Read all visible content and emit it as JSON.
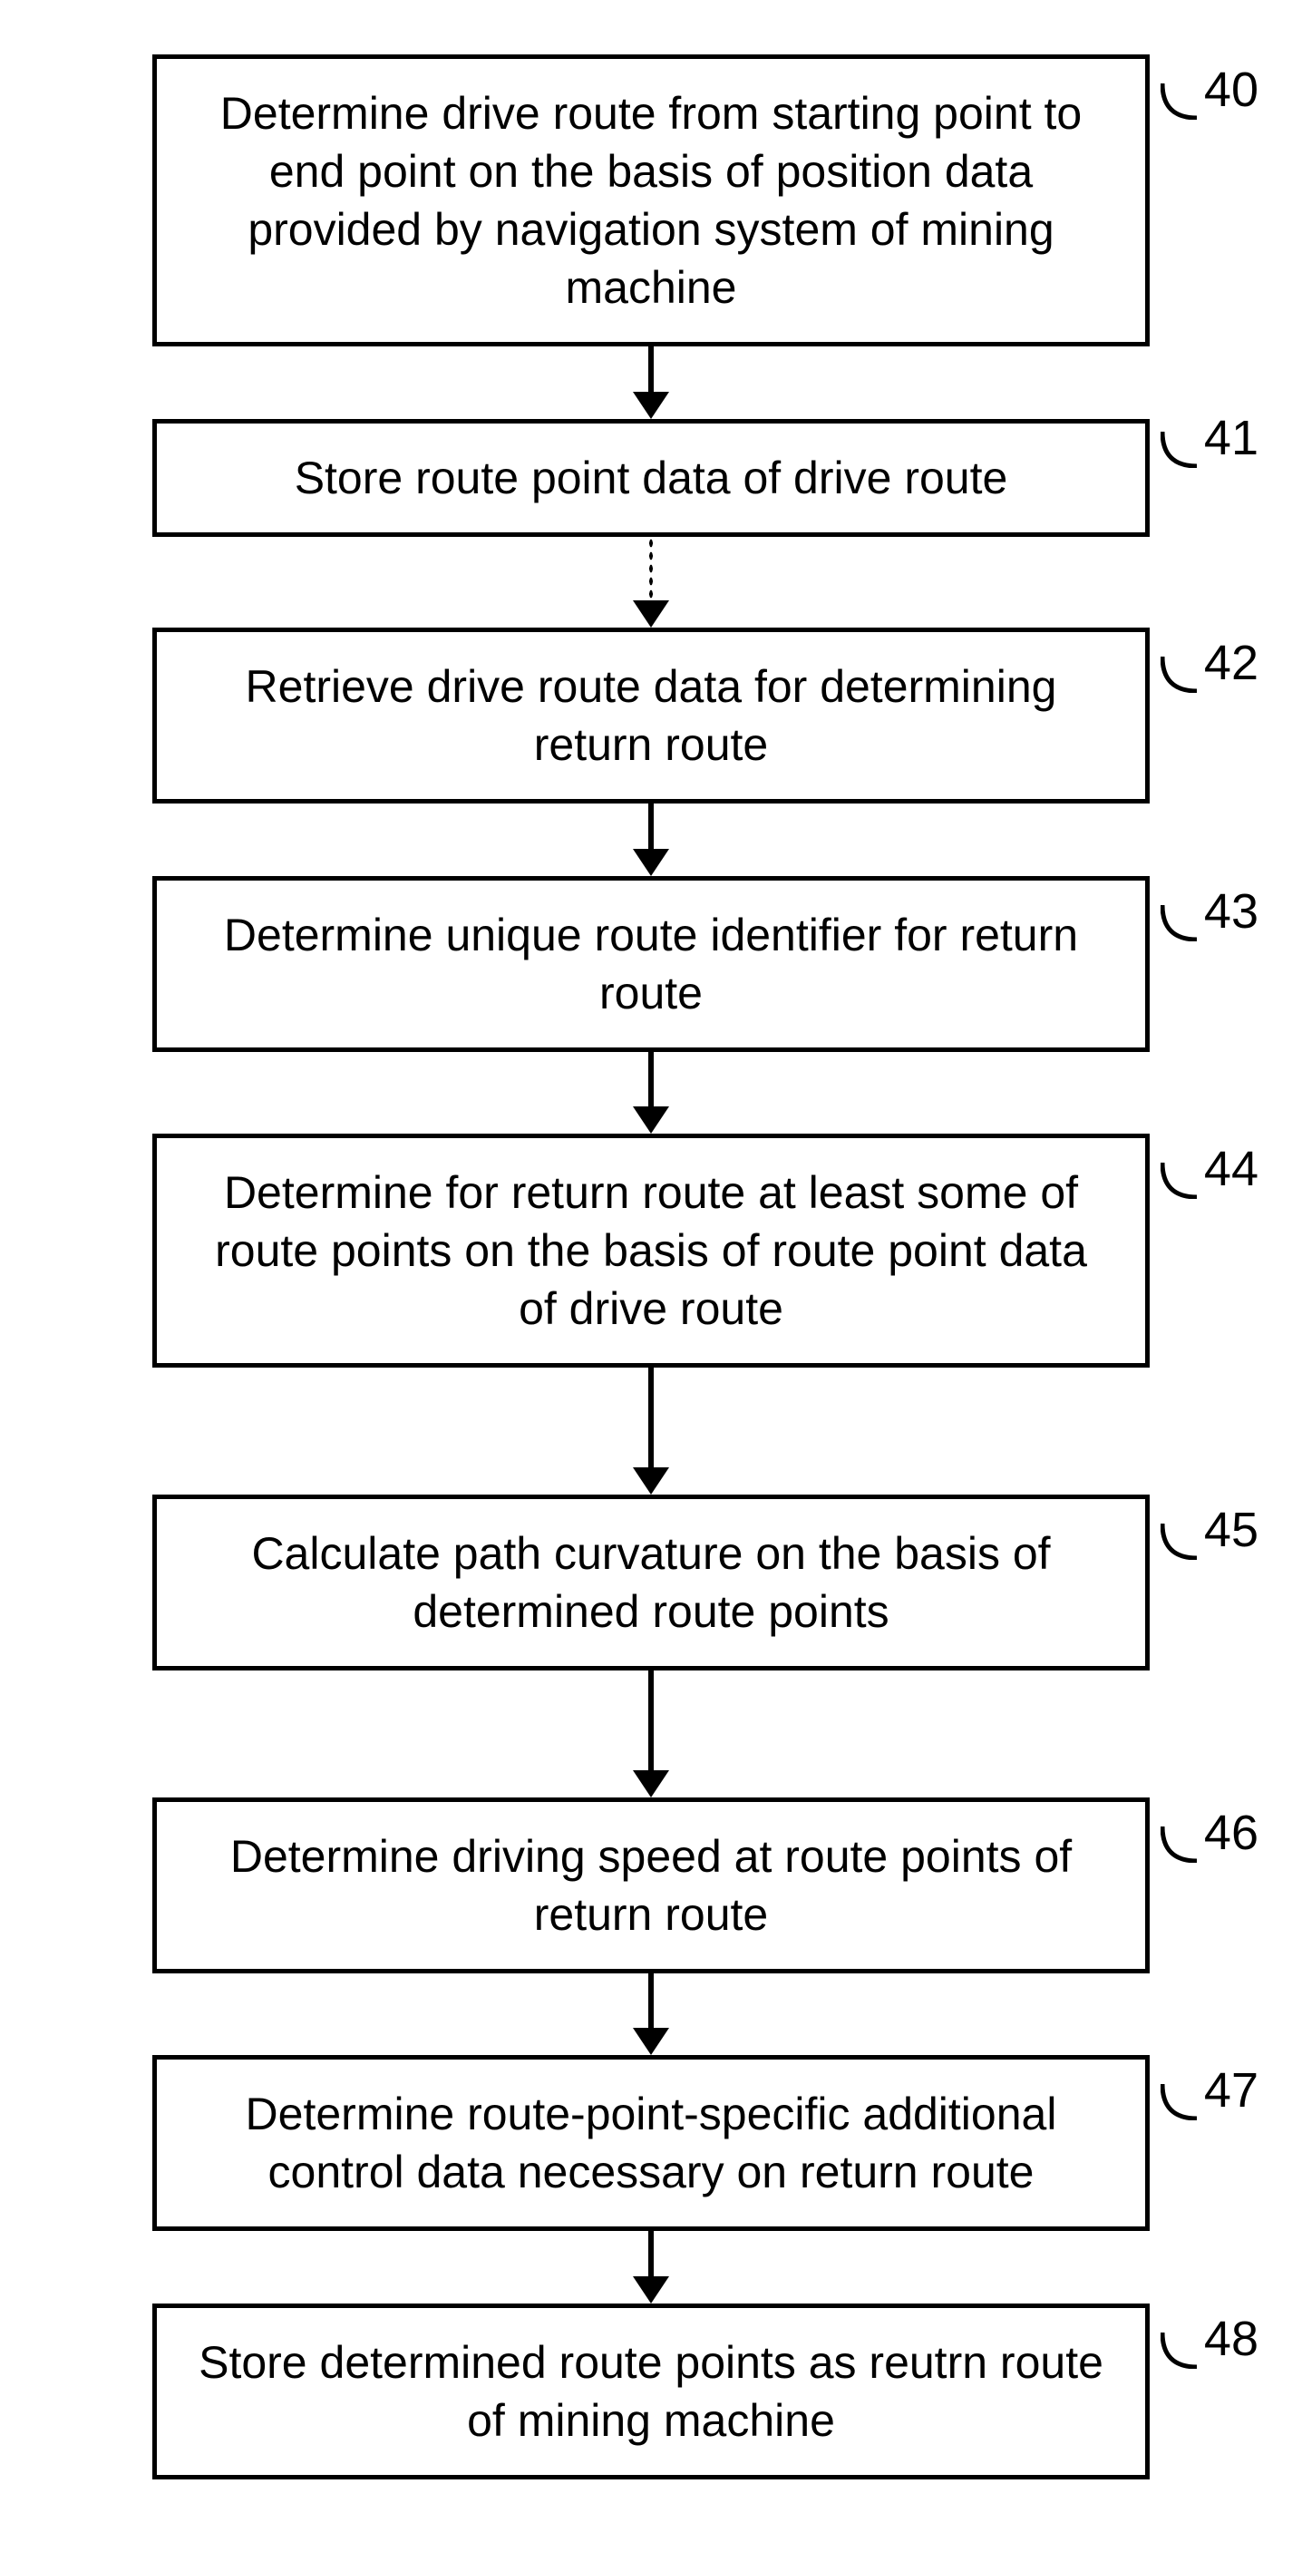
{
  "diagram": {
    "type": "flowchart",
    "steps": [
      {
        "id": "40",
        "text": "Determine drive route from starting point to end point on the basis of position data provided by navigation system of mining machine",
        "height": "h1",
        "arrow_after": "solid"
      },
      {
        "id": "41",
        "text": "Store route point data of drive route",
        "height": "h4",
        "arrow_after": "dotted"
      },
      {
        "id": "42",
        "text": "Retrieve drive route data for determining return route",
        "height": "h2",
        "arrow_after": "solid"
      },
      {
        "id": "43",
        "text": "Determine unique route identifier for return route",
        "height": "h2",
        "arrow_after": "solid"
      },
      {
        "id": "44",
        "text": "Determine for return route at least some of route points on the basis of route point data of drive route",
        "height": "h3",
        "arrow_after": "solid-long"
      },
      {
        "id": "45",
        "text": "Calculate path curvature on the basis of determined route points",
        "height": "h2",
        "arrow_after": "solid-long"
      },
      {
        "id": "46",
        "text": "Determine driving speed at route points of return route",
        "height": "h2",
        "arrow_after": "solid"
      },
      {
        "id": "47",
        "text": "Determine route-point-specific additional control data necessary on return route",
        "height": "h2",
        "arrow_after": "solid"
      },
      {
        "id": "48",
        "text": "Store determined route points as reutrn route of mining machine",
        "height": "h2",
        "arrow_after": "none"
      }
    ]
  }
}
